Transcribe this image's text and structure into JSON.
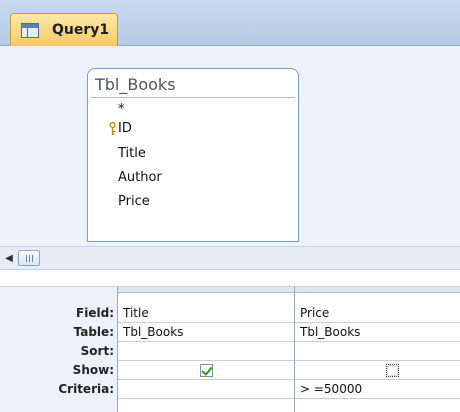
{
  "tab": {
    "label": "Query1",
    "icon": "query-icon"
  },
  "field_list": {
    "title": "Tbl_Books",
    "fields": [
      "*",
      "ID",
      "Title",
      "Author",
      "Price"
    ],
    "primary_key": "ID"
  },
  "grid": {
    "row_labels": {
      "field": "Field:",
      "table": "Table:",
      "sort": "Sort:",
      "show": "Show:",
      "criteria": "Criteria:"
    },
    "columns": [
      {
        "field": "Title",
        "table": "Tbl_Books",
        "sort": "",
        "show": true,
        "criteria": ""
      },
      {
        "field": "Price",
        "table": "Tbl_Books",
        "sort": "",
        "show": false,
        "criteria": "> =50000"
      }
    ]
  },
  "colors": {
    "tab_active": "#f8c765",
    "design_bg": "#edf2fa",
    "check": "#249a18"
  }
}
